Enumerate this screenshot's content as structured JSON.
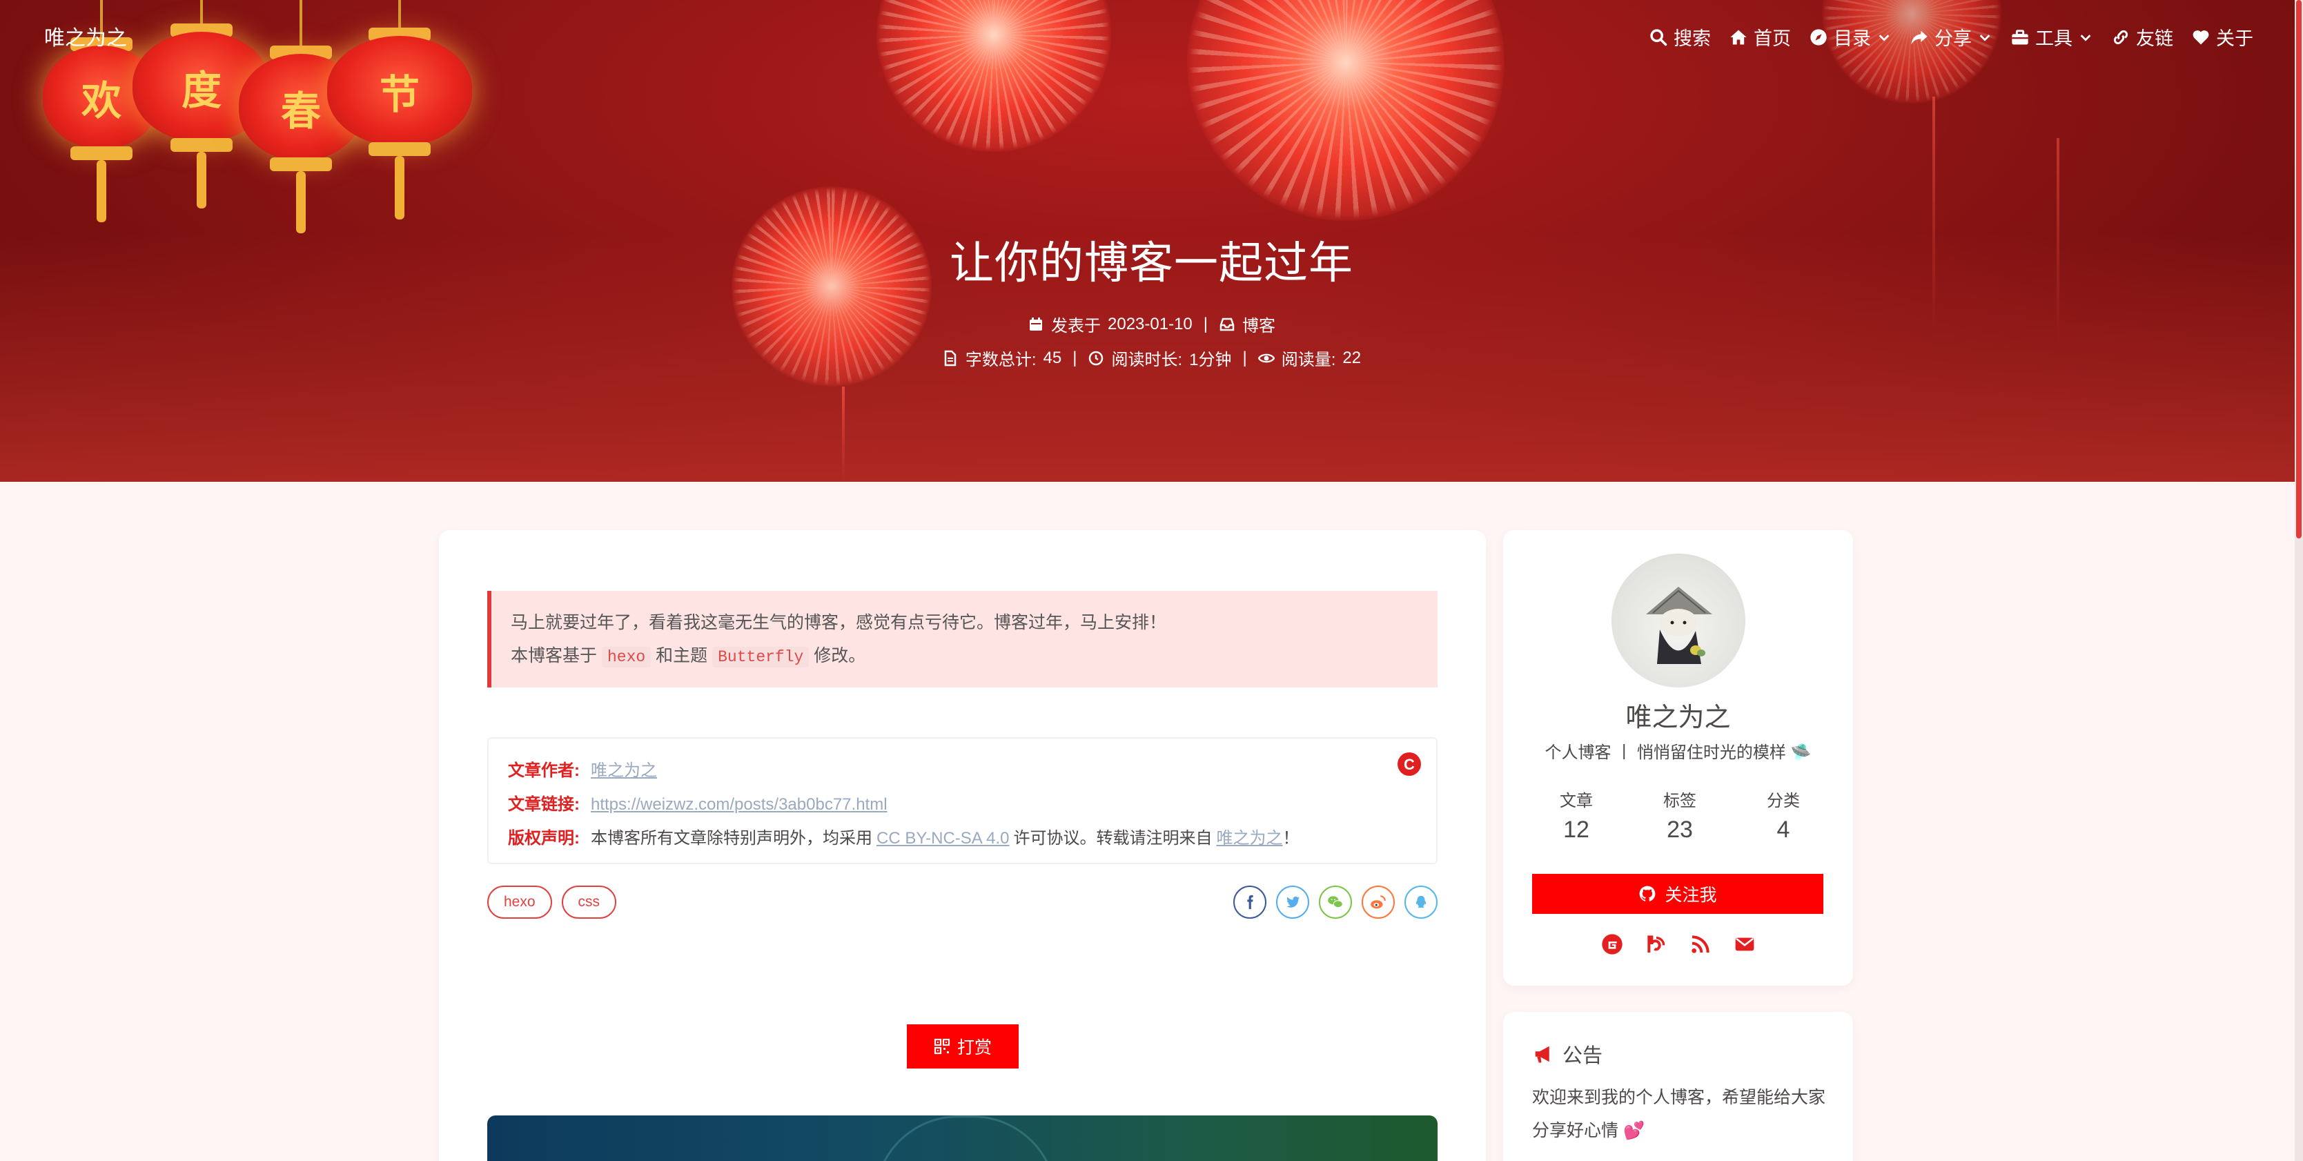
{
  "site": {
    "name": "唯之为之"
  },
  "nav": {
    "items": [
      {
        "label": "搜索",
        "icon": "search-icon"
      },
      {
        "label": "首页",
        "icon": "home-icon"
      },
      {
        "label": "目录",
        "icon": "compass-icon",
        "dropdown": true
      },
      {
        "label": "分享",
        "icon": "share-icon",
        "dropdown": true
      },
      {
        "label": "工具",
        "icon": "toolbox-icon",
        "dropdown": true
      },
      {
        "label": "友链",
        "icon": "link-icon"
      },
      {
        "label": "关于",
        "icon": "heart-icon"
      }
    ]
  },
  "banner": {
    "lantern_chars": [
      "欢",
      "度",
      "春",
      "节"
    ]
  },
  "post": {
    "title": "让你的博客一起过年",
    "published_label": "发表于",
    "published_date": "2023-01-10",
    "category": "博客",
    "wordcount_label": "字数总计:",
    "wordcount": "45",
    "readtime_label": "阅读时长:",
    "readtime": "1分钟",
    "views_label": "阅读量:",
    "views": "22"
  },
  "note": {
    "line1": "马上就要过年了，看着我这毫无生气的博客，感觉有点亏待它。博客过年，马上安排！",
    "line2_prefix": "本博客基于",
    "code1": "hexo",
    "line2_mid": "和主题",
    "code2": "Butterfly",
    "line2_suffix": "修改。"
  },
  "copyright": {
    "author_label": "文章作者:",
    "author": "唯之为之",
    "link_label": "文章链接:",
    "link": "https://weizwz.com/posts/3ab0bc77.html",
    "license_label": "版权声明:",
    "license_prefix": "本博客所有文章除特别声明外，均采用",
    "license_name": "CC BY-NC-SA 4.0",
    "license_mid": "许可协议。转载请注明来自",
    "license_author": "唯之为之",
    "license_suffix": "！",
    "badge": "C"
  },
  "tags": [
    "hexo",
    "css"
  ],
  "share": [
    {
      "icon": "facebook-icon",
      "glyph": "f",
      "color": "#3b5998"
    },
    {
      "icon": "twitter-icon",
      "glyph": "t",
      "color": "#55acee"
    },
    {
      "icon": "wechat-icon",
      "glyph": "w",
      "color": "#7bc549"
    },
    {
      "icon": "weibo-icon",
      "glyph": "wb",
      "color": "#ff763b"
    },
    {
      "icon": "qq-icon",
      "glyph": "q",
      "color": "#56b6e7"
    }
  ],
  "reward": {
    "label": "打赏"
  },
  "author_card": {
    "name": "唯之为之",
    "desc": "个人博客 丨 悄悄留住时光的模样 🛸",
    "stats": [
      {
        "label": "文章",
        "value": "12"
      },
      {
        "label": "标签",
        "value": "23"
      },
      {
        "label": "分类",
        "value": "4"
      }
    ],
    "follow_label": "关注我",
    "social": [
      "gitee-icon",
      "blog-icon",
      "rss-icon",
      "mail-icon"
    ]
  },
  "announcement": {
    "title": "公告",
    "text": "欢迎来到我的个人博客，希望能给大家分享好心情 💕"
  },
  "colors": {
    "accent": "#ff0000",
    "link": "#99a9bf",
    "banner": "#8e1515"
  }
}
